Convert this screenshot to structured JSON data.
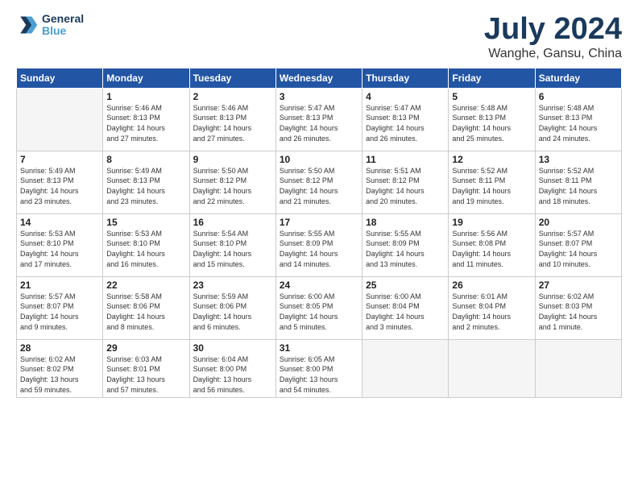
{
  "logo": {
    "line1": "General",
    "line2": "Blue"
  },
  "title": "July 2024",
  "location": "Wanghe, Gansu, China",
  "header": {
    "days": [
      "Sunday",
      "Monday",
      "Tuesday",
      "Wednesday",
      "Thursday",
      "Friday",
      "Saturday"
    ]
  },
  "weeks": [
    [
      {
        "day": "",
        "info": ""
      },
      {
        "day": "1",
        "info": "Sunrise: 5:46 AM\nSunset: 8:13 PM\nDaylight: 14 hours\nand 27 minutes."
      },
      {
        "day": "2",
        "info": "Sunrise: 5:46 AM\nSunset: 8:13 PM\nDaylight: 14 hours\nand 27 minutes."
      },
      {
        "day": "3",
        "info": "Sunrise: 5:47 AM\nSunset: 8:13 PM\nDaylight: 14 hours\nand 26 minutes."
      },
      {
        "day": "4",
        "info": "Sunrise: 5:47 AM\nSunset: 8:13 PM\nDaylight: 14 hours\nand 26 minutes."
      },
      {
        "day": "5",
        "info": "Sunrise: 5:48 AM\nSunset: 8:13 PM\nDaylight: 14 hours\nand 25 minutes."
      },
      {
        "day": "6",
        "info": "Sunrise: 5:48 AM\nSunset: 8:13 PM\nDaylight: 14 hours\nand 24 minutes."
      }
    ],
    [
      {
        "day": "7",
        "info": "Sunrise: 5:49 AM\nSunset: 8:13 PM\nDaylight: 14 hours\nand 23 minutes."
      },
      {
        "day": "8",
        "info": "Sunrise: 5:49 AM\nSunset: 8:13 PM\nDaylight: 14 hours\nand 23 minutes."
      },
      {
        "day": "9",
        "info": "Sunrise: 5:50 AM\nSunset: 8:12 PM\nDaylight: 14 hours\nand 22 minutes."
      },
      {
        "day": "10",
        "info": "Sunrise: 5:50 AM\nSunset: 8:12 PM\nDaylight: 14 hours\nand 21 minutes."
      },
      {
        "day": "11",
        "info": "Sunrise: 5:51 AM\nSunset: 8:12 PM\nDaylight: 14 hours\nand 20 minutes."
      },
      {
        "day": "12",
        "info": "Sunrise: 5:52 AM\nSunset: 8:11 PM\nDaylight: 14 hours\nand 19 minutes."
      },
      {
        "day": "13",
        "info": "Sunrise: 5:52 AM\nSunset: 8:11 PM\nDaylight: 14 hours\nand 18 minutes."
      }
    ],
    [
      {
        "day": "14",
        "info": "Sunrise: 5:53 AM\nSunset: 8:10 PM\nDaylight: 14 hours\nand 17 minutes."
      },
      {
        "day": "15",
        "info": "Sunrise: 5:53 AM\nSunset: 8:10 PM\nDaylight: 14 hours\nand 16 minutes."
      },
      {
        "day": "16",
        "info": "Sunrise: 5:54 AM\nSunset: 8:10 PM\nDaylight: 14 hours\nand 15 minutes."
      },
      {
        "day": "17",
        "info": "Sunrise: 5:55 AM\nSunset: 8:09 PM\nDaylight: 14 hours\nand 14 minutes."
      },
      {
        "day": "18",
        "info": "Sunrise: 5:55 AM\nSunset: 8:09 PM\nDaylight: 14 hours\nand 13 minutes."
      },
      {
        "day": "19",
        "info": "Sunrise: 5:56 AM\nSunset: 8:08 PM\nDaylight: 14 hours\nand 11 minutes."
      },
      {
        "day": "20",
        "info": "Sunrise: 5:57 AM\nSunset: 8:07 PM\nDaylight: 14 hours\nand 10 minutes."
      }
    ],
    [
      {
        "day": "21",
        "info": "Sunrise: 5:57 AM\nSunset: 8:07 PM\nDaylight: 14 hours\nand 9 minutes."
      },
      {
        "day": "22",
        "info": "Sunrise: 5:58 AM\nSunset: 8:06 PM\nDaylight: 14 hours\nand 8 minutes."
      },
      {
        "day": "23",
        "info": "Sunrise: 5:59 AM\nSunset: 8:06 PM\nDaylight: 14 hours\nand 6 minutes."
      },
      {
        "day": "24",
        "info": "Sunrise: 6:00 AM\nSunset: 8:05 PM\nDaylight: 14 hours\nand 5 minutes."
      },
      {
        "day": "25",
        "info": "Sunrise: 6:00 AM\nSunset: 8:04 PM\nDaylight: 14 hours\nand 3 minutes."
      },
      {
        "day": "26",
        "info": "Sunrise: 6:01 AM\nSunset: 8:04 PM\nDaylight: 14 hours\nand 2 minutes."
      },
      {
        "day": "27",
        "info": "Sunrise: 6:02 AM\nSunset: 8:03 PM\nDaylight: 14 hours\nand 1 minute."
      }
    ],
    [
      {
        "day": "28",
        "info": "Sunrise: 6:02 AM\nSunset: 8:02 PM\nDaylight: 13 hours\nand 59 minutes."
      },
      {
        "day": "29",
        "info": "Sunrise: 6:03 AM\nSunset: 8:01 PM\nDaylight: 13 hours\nand 57 minutes."
      },
      {
        "day": "30",
        "info": "Sunrise: 6:04 AM\nSunset: 8:00 PM\nDaylight: 13 hours\nand 56 minutes."
      },
      {
        "day": "31",
        "info": "Sunrise: 6:05 AM\nSunset: 8:00 PM\nDaylight: 13 hours\nand 54 minutes."
      },
      {
        "day": "",
        "info": ""
      },
      {
        "day": "",
        "info": ""
      },
      {
        "day": "",
        "info": ""
      }
    ]
  ]
}
